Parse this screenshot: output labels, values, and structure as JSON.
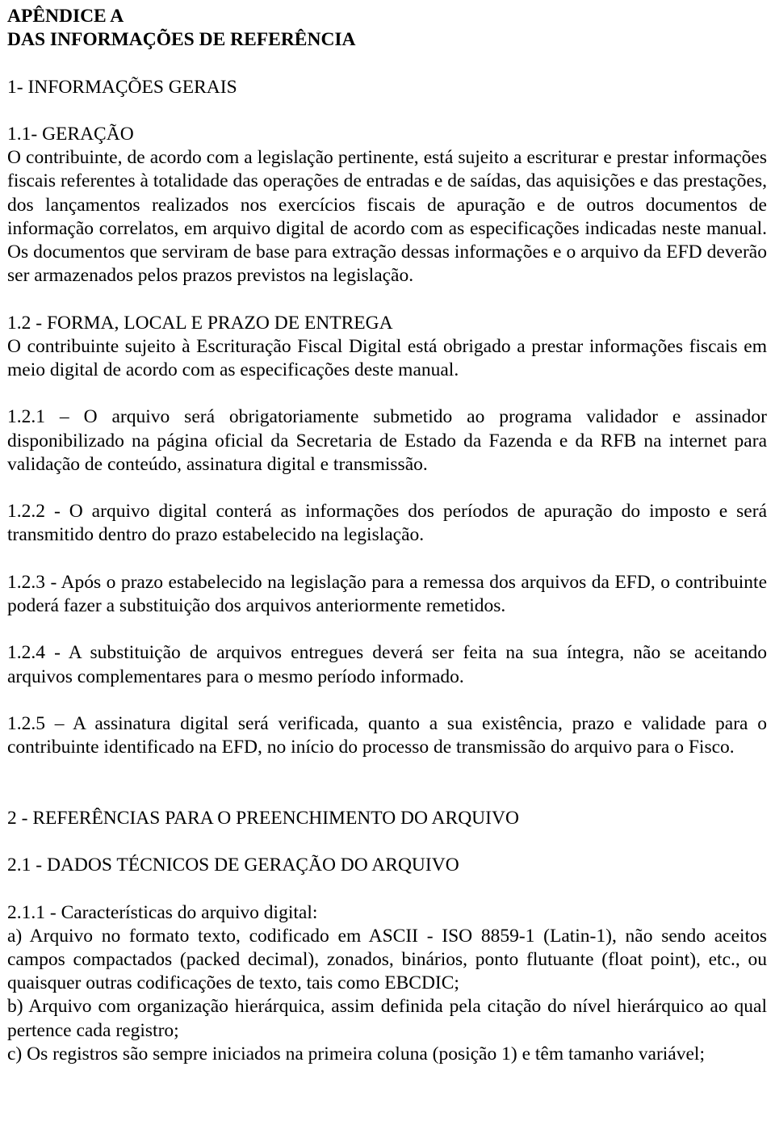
{
  "document": {
    "title_lines": [
      "APÊNDICE A",
      "DAS INFORMAÇÕES DE REFERÊNCIA"
    ],
    "headings": {
      "s1": "1- INFORMAÇÕES GERAIS",
      "s1_1": "1.1- GERAÇÃO",
      "s1_2": "1.2 - FORMA, LOCAL E PRAZO DE ENTREGA",
      "s2": "2 - REFERÊNCIAS PARA O PREENCHIMENTO DO ARQUIVO",
      "s2_1": "2.1 - DADOS TÉCNICOS DE GERAÇÃO DO ARQUIVO"
    },
    "paragraphs": {
      "p1_1": "O contribuinte, de acordo com a legislação pertinente, está sujeito a escriturar e prestar informações fiscais referentes à totalidade das operações de entradas e de saídas, das aquisições e das prestações, dos lançamentos realizados nos exercícios fiscais de apuração e de outros documentos de informação correlatos, em arquivo digital de acordo com as especificações indicadas neste manual. Os documentos que serviram de base para extração dessas informações e o arquivo da EFD deverão ser armazenados pelos prazos previstos na legislação.",
      "p1_2": "O contribuinte sujeito à Escrituração Fiscal Digital está obrigado a prestar informações fiscais em meio digital de acordo com as especificações deste manual.",
      "p1_2_1": "1.2.1 – O arquivo será obrigatoriamente submetido ao programa validador e assinador disponibilizado na página oficial da Secretaria de Estado da Fazenda e da RFB na internet para validação de conteúdo, assinatura digital e transmissão.",
      "p1_2_2": "1.2.2 - O arquivo digital conterá as informações dos períodos de apuração do imposto e será transmitido dentro do prazo estabelecido na legislação.",
      "p1_2_3": "1.2.3 - Após o prazo estabelecido na legislação para a remessa dos arquivos da EFD, o contribuinte poderá fazer a substituição dos arquivos anteriormente remetidos.",
      "p1_2_4": "1.2.4 - A substituição de arquivos entregues deverá ser feita na sua íntegra, não se aceitando arquivos complementares para o mesmo período informado.",
      "p1_2_5": "1.2.5 – A assinatura digital será verificada, quanto a sua existência, prazo e validade para o contribuinte identificado na EFD, no início do processo de transmissão do arquivo para o Fisco.",
      "p2_1_1": "2.1.1 - Características do arquivo digital:",
      "item_a": "a) Arquivo no formato texto, codificado em ASCII - ISO 8859-1 (Latin-1), não sendo aceitos campos compactados (packed decimal), zonados, binários, ponto flutuante (float point), etc., ou quaisquer outras codificações de texto, tais como EBCDIC;",
      "item_b": "b) Arquivo com organização hierárquica, assim definida pela citação do nível hierárquico ao qual pertence cada registro;",
      "item_c": "c) Os registros são sempre iniciados na primeira coluna (posição 1) e têm tamanho variável;"
    }
  }
}
